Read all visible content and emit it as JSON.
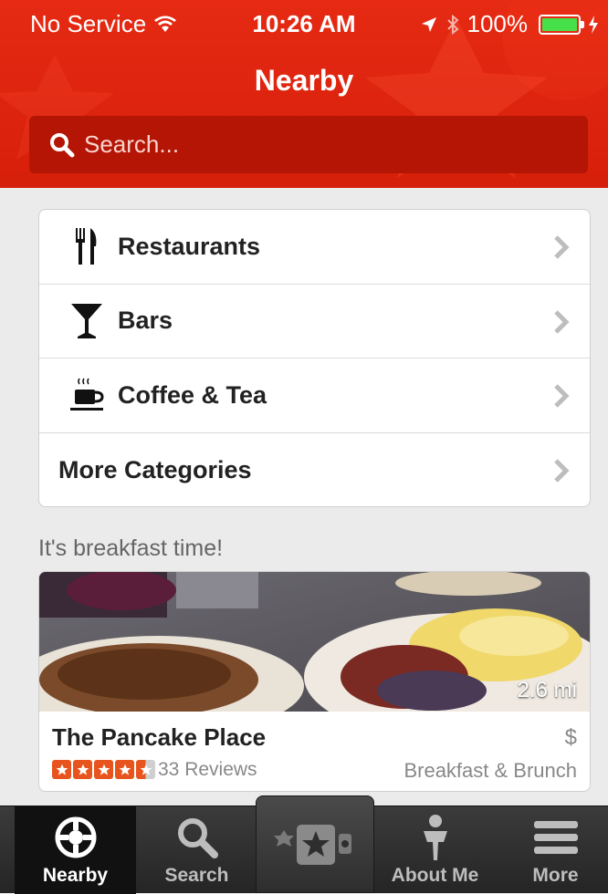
{
  "status_bar": {
    "carrier": "No Service",
    "time": "10:26 AM",
    "battery": "100%"
  },
  "header": {
    "title": "Nearby",
    "search_placeholder": "Search..."
  },
  "categories": [
    {
      "label": "Restaurants",
      "icon": "fork-knife-icon"
    },
    {
      "label": "Bars",
      "icon": "cocktail-glass-icon"
    },
    {
      "label": "Coffee & Tea",
      "icon": "coffee-cup-icon"
    },
    {
      "label": "More Categories",
      "icon": ""
    }
  ],
  "featured": {
    "heading": "It's breakfast time!",
    "business": {
      "name": "The Pancake Place",
      "distance": "2.6 mi",
      "price": "$",
      "rating": 4.5,
      "reviews": "33 Reviews",
      "category": "Breakfast & Brunch"
    }
  },
  "tabbar": {
    "tabs": [
      {
        "label": "Nearby",
        "icon": "nearby-compass-icon",
        "active": true
      },
      {
        "label": "Search",
        "icon": "search-icon",
        "active": false
      },
      {
        "label": "About Me",
        "icon": "person-icon",
        "active": false
      },
      {
        "label": "More",
        "icon": "menu-icon",
        "active": false
      }
    ],
    "center_icon": "check-in-star-icon"
  },
  "colors": {
    "brand_red": "#d61f0a",
    "search_bg": "#b41504",
    "star_orange": "#e8541d",
    "battery_green": "#46e04b"
  }
}
